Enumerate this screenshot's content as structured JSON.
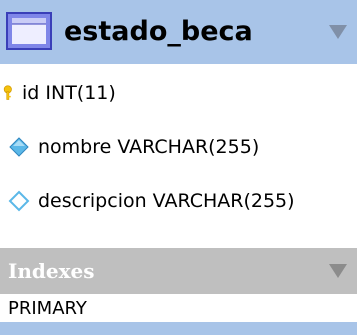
{
  "table": {
    "name": "estado_beca",
    "header_color": "#a8c4e8",
    "icon": "table-icon",
    "collapse_icon": "chevron-down-icon"
  },
  "columns": [
    {
      "label": "id INT(11)",
      "icon": "primary-key-icon",
      "icon_color": "#f4c20d"
    },
    {
      "label": "nombre VARCHAR(255)",
      "icon": "not-null-column-icon",
      "icon_color": "#5bb8e8"
    },
    {
      "label": "descripcion VARCHAR(255)",
      "icon": "nullable-column-icon",
      "icon_color": "#5bb8e8"
    }
  ],
  "indexes": {
    "label": "Indexes",
    "header_color": "#bfbfbf",
    "items": [
      "PRIMARY"
    ]
  }
}
